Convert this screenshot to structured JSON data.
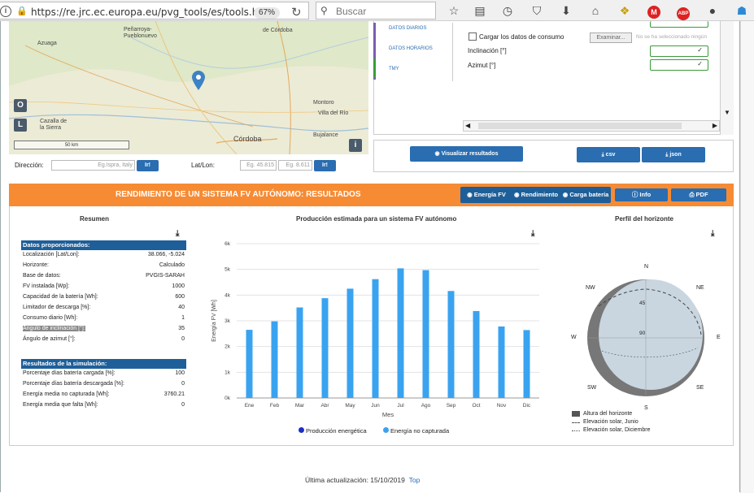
{
  "browser": {
    "url": "https://re.jrc.ec.europa.eu/pvg_tools/es/tools.ht",
    "zoom": "67%",
    "search_placeholder": "Buscar",
    "adblock_label": "ABP"
  },
  "map": {
    "labels": [
      "Peñarroya-Pueblonuevo",
      "de Córdoba",
      "Azuaga",
      "Montoro",
      "Villa del Río",
      "Cazalla de la Sierra",
      "Córdoba",
      "Bujalance"
    ],
    "scale": "50 km",
    "btn_o": "O",
    "btn_l": "L",
    "info": "i"
  },
  "location_form": {
    "address_label": "Dirección:",
    "address_placeholder": "Eg.Ispra, Italy",
    "go1": "Ir!",
    "latlon_label": "Lat/Lon:",
    "lat_placeholder": "Eg. 45.815",
    "lon_placeholder": "Eg. 8.611",
    "go2": "Ir!"
  },
  "side_panel": {
    "links": [
      "DATOS DIARIOS",
      "DATOS HORARIOS",
      "TMY"
    ],
    "consumption_check": "Cargar los datos de consumo",
    "browse_button": "Examinar...",
    "no_file": "No se ha seleccionado ningún",
    "inclination_label": "Inclinación [°]",
    "azimuth_label": "Azimut [°]"
  },
  "actions": {
    "view_results": "Visualizar resultados",
    "csv": "csv",
    "json": "json"
  },
  "results": {
    "title": "RENDIMIENTO DE UN SISTEMA FV AUTÓNOMO: RESULTADOS",
    "tabs": [
      "Energía FV",
      "Rendimiento",
      "Carga batería"
    ],
    "info_button": "Info",
    "pdf_button": "PDF",
    "summary_title": "Resumen",
    "provided_header": "Datos proporcionados:",
    "provided": [
      {
        "label": "Localización [Lat/Lon]:",
        "value": "38.066, -5.024"
      },
      {
        "label": "Horizonte:",
        "value": "Calculado"
      },
      {
        "label": "Base de datos:",
        "value": "PVGIS-SARAH"
      },
      {
        "label": "FV instalada [Wp]:",
        "value": "1000"
      },
      {
        "label": "Capacidad de la batería [Wh]:",
        "value": "600"
      },
      {
        "label": "Limitador de descarga [%]:",
        "value": "40"
      },
      {
        "label": "Consumo diario [Wh]:",
        "value": "1"
      },
      {
        "label": "Ángulo de inclinación [°]:",
        "value": "35"
      },
      {
        "label": "Ángulo de azimut [°]:",
        "value": "0"
      }
    ],
    "sim_header": "Resultados de la simulación:",
    "simulation": [
      {
        "label": "Porcentaje días batería cargada [%]:",
        "value": "100"
      },
      {
        "label": "Porcentaje días batería descargada [%]:",
        "value": "0"
      },
      {
        "label": "Energía media no capturada [Wh]:",
        "value": "3760.21"
      },
      {
        "label": "Energía media que falta [Wh]:",
        "value": "0"
      }
    ],
    "chart_title": "Producción estimada para un sistema FV autónomo",
    "horizon_title": "Perfil del horizonte",
    "horizon_legend": [
      "Altura del horizonte",
      "Elevación solar, Junio",
      "Elevación solar, Diciembre"
    ],
    "compass": {
      "n": "N",
      "ne": "NE",
      "e": "E",
      "se": "SE",
      "s": "S",
      "sw": "SW",
      "w": "W",
      "nw": "NW",
      "r45": "45",
      "r90": "90"
    }
  },
  "chart_data": {
    "type": "bar",
    "categories": [
      "Ene",
      "Feb",
      "Mar",
      "Abr",
      "May",
      "Jun",
      "Jul",
      "Ago",
      "Sep",
      "Oct",
      "Nov",
      "Dic"
    ],
    "series": [
      {
        "name": "Producción energética",
        "values": [
          0,
          0,
          0,
          0,
          0,
          0,
          0,
          0,
          0,
          0,
          0,
          0
        ],
        "color": "#1a2fc2"
      },
      {
        "name": "Energía no capturada",
        "values": [
          2650,
          2980,
          3520,
          3880,
          4250,
          4620,
          5040,
          4970,
          4160,
          3380,
          2780,
          2640
        ],
        "color": "#3aa3f0"
      }
    ],
    "xlabel": "Mes",
    "ylabel": "Energía FV [Wh]",
    "yticks": [
      "0k",
      "1k",
      "2k",
      "3k",
      "4k",
      "5k",
      "6k"
    ],
    "ylim": [
      0,
      6000
    ],
    "grid": true,
    "legend": "bottom"
  },
  "footer": {
    "updated": "Última actualización: 15/10/2019",
    "top": "Top"
  }
}
